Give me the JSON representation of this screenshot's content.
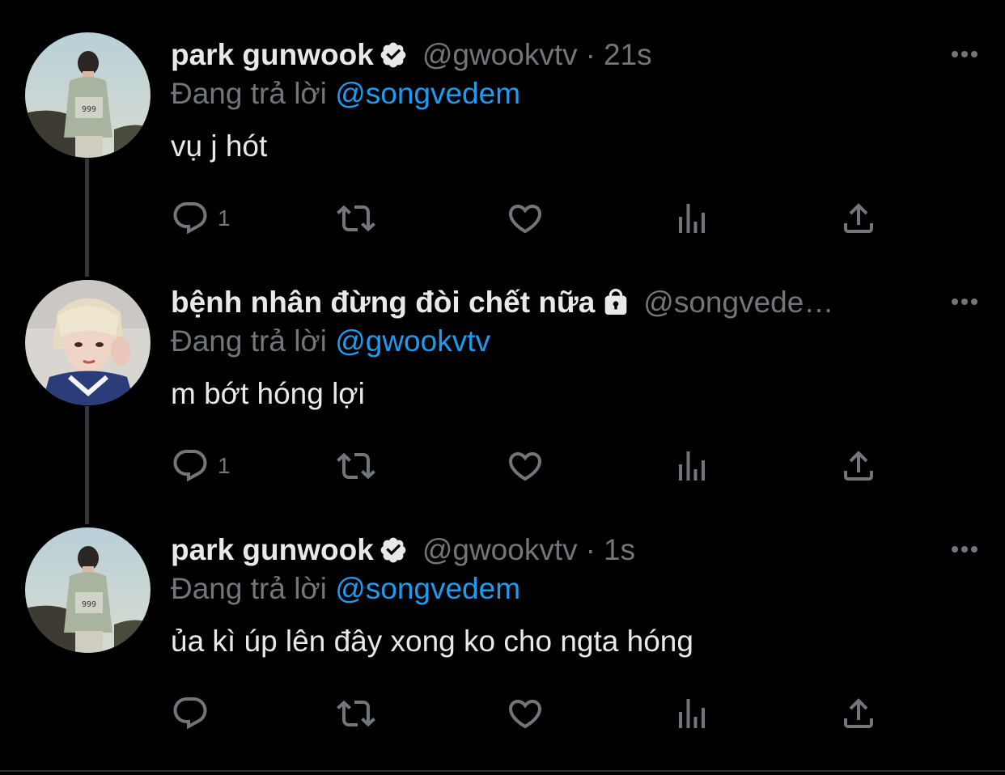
{
  "colors": {
    "background": "#000000",
    "text": "#e7e9ea",
    "muted": "#71767b",
    "link": "#1d9bf0",
    "thread_line": "#333639"
  },
  "tweets": [
    {
      "name": "park gunwook",
      "badge": "verified-badge-icon",
      "handle": "@gwookvtv",
      "time": "21s",
      "reply_prefix": "Đang trả lời",
      "reply_to": "@songvedem",
      "text": "vụ j hót",
      "reply_count": "1"
    },
    {
      "name": "bệnh nhân đừng đòi chết nữa",
      "badge": "lock-icon",
      "handle": "@songvede…",
      "time": "",
      "reply_prefix": "Đang trả lời",
      "reply_to": "@gwookvtv",
      "text": "m bớt hóng lợi",
      "reply_count": "1"
    },
    {
      "name": "park gunwook",
      "badge": "verified-badge-icon",
      "handle": "@gwookvtv",
      "time": "1s",
      "reply_prefix": "Đang trả lời",
      "reply_to": "@songvedem",
      "text": "ủa kì úp lên đây xong ko cho ngta hóng",
      "reply_count": ""
    }
  ],
  "separator": "·"
}
